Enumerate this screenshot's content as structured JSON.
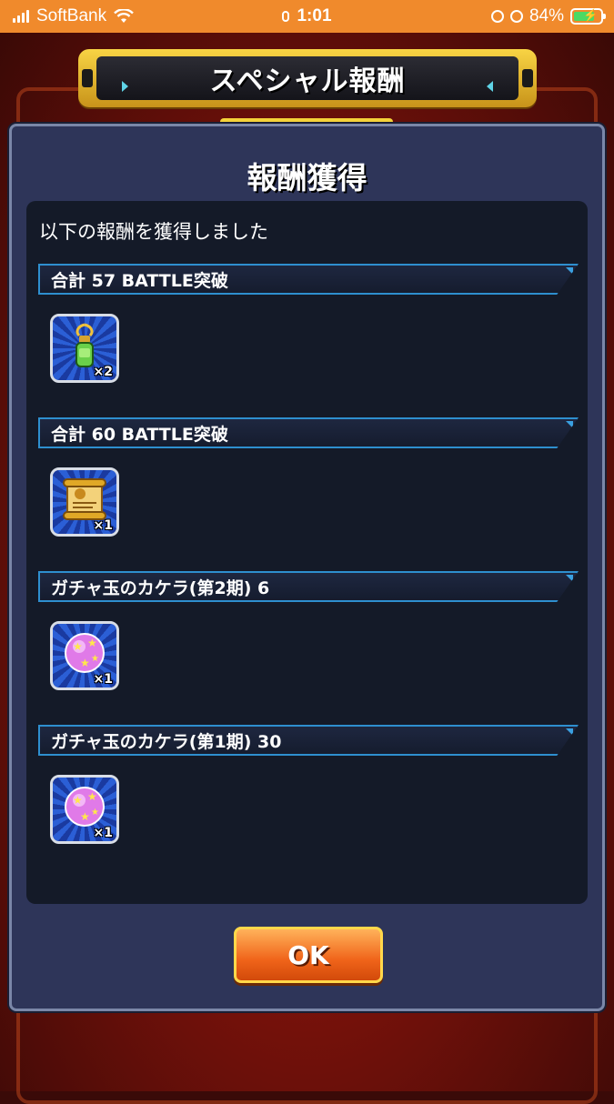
{
  "status_bar": {
    "carrier": "SoftBank",
    "time": "1:01",
    "battery": "84%",
    "battery_level": 0.84
  },
  "banner": {
    "title": "スペシャル報酬"
  },
  "dialog": {
    "title": "報酬獲得",
    "subtitle": "以下の報酬を獲得しました",
    "rewards": [
      {
        "label": "合計 57 BATTLE突破",
        "item_icon": "bottle-icon",
        "quantity": "×2"
      },
      {
        "label": "合計 60 BATTLE突破",
        "item_icon": "scroll-icon",
        "quantity": "×1"
      },
      {
        "label": "ガチャ玉のカケラ(第2期) 6",
        "item_icon": "gacha-orb-icon",
        "quantity": "×1"
      },
      {
        "label": "ガチャ玉のカケラ(第1期) 30",
        "item_icon": "gacha-orb-icon",
        "quantity": "×1"
      }
    ],
    "ok_label": "OK"
  },
  "colors": {
    "status_bar": "#f08a2c",
    "dialog_bg": "#2e3559",
    "accent_blue": "#2e8fcf",
    "ok_button": "#f0641a",
    "banner_gold": "#f8d444"
  }
}
